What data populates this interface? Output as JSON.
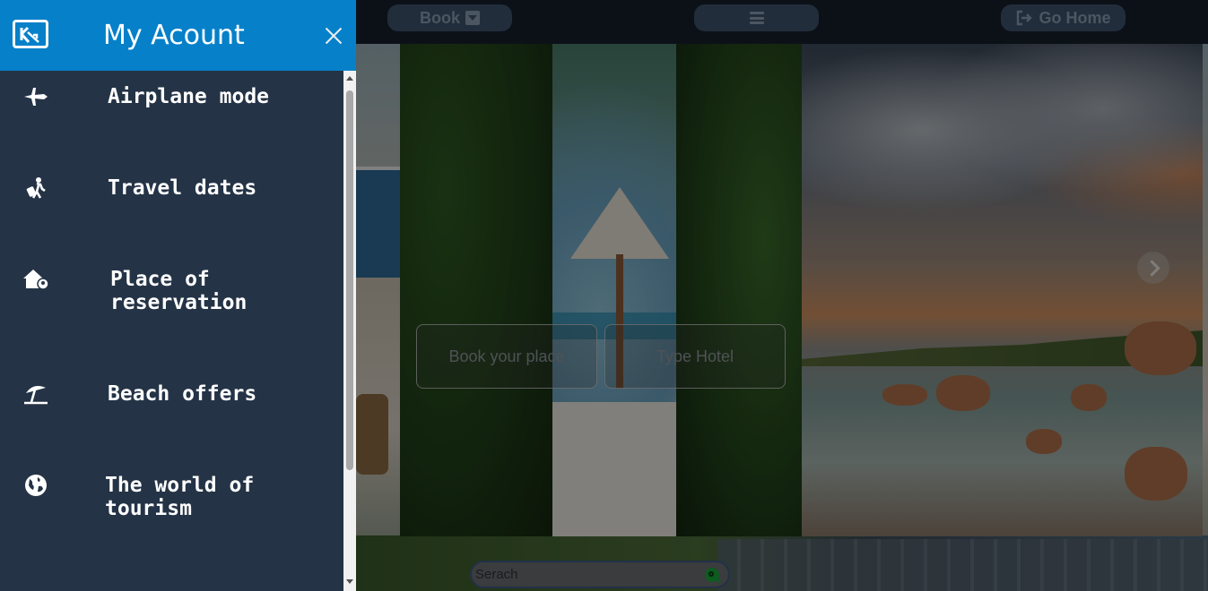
{
  "topbar": {
    "book_label": "Book",
    "home_label": "Go Home"
  },
  "drawer": {
    "title": "My Acount",
    "items": [
      {
        "label": "Airplane mode",
        "icon": "airplane-icon"
      },
      {
        "label": "Travel dates",
        "icon": "traveler-icon"
      },
      {
        "label": "Place of reservation",
        "icon": "house-location-icon"
      },
      {
        "label": "Beach offers",
        "icon": "umbrella-beach-icon"
      },
      {
        "label": "The world of tourism",
        "icon": "globe-icon"
      }
    ]
  },
  "booking": {
    "place_placeholder": "Book your place",
    "hotel_placeholder": "Type Hotel"
  },
  "search": {
    "placeholder": "Serach"
  },
  "colors": {
    "drawer_header": "#0680c9",
    "drawer_bg": "#243346",
    "topbar_bg": "#17202c",
    "pill_bg": "#3e536d",
    "search_icon": "#18a63a"
  }
}
